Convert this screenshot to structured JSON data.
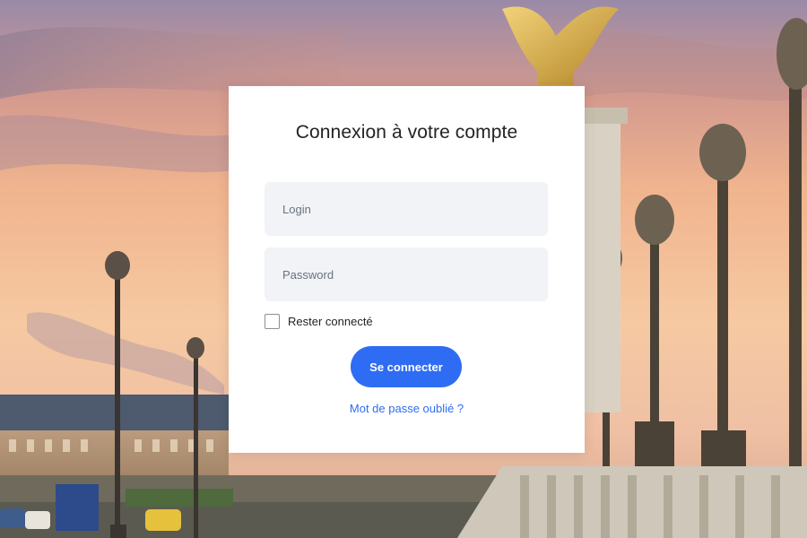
{
  "background": {
    "description_icon": "paris-pont-alexandre-iii-photo"
  },
  "login_card": {
    "title": "Connexion à votre compte",
    "login_placeholder": "Login",
    "login_value": "",
    "password_placeholder": "Password",
    "password_value": "",
    "remember_label": "Rester connecté",
    "remember_checked": false,
    "submit_label": "Se connecter",
    "forgot_label": "Mot de passe oublié ?"
  },
  "colors": {
    "accent": "#2f6cf4",
    "field_bg": "#f1f3f6",
    "card_bg": "#ffffff"
  }
}
